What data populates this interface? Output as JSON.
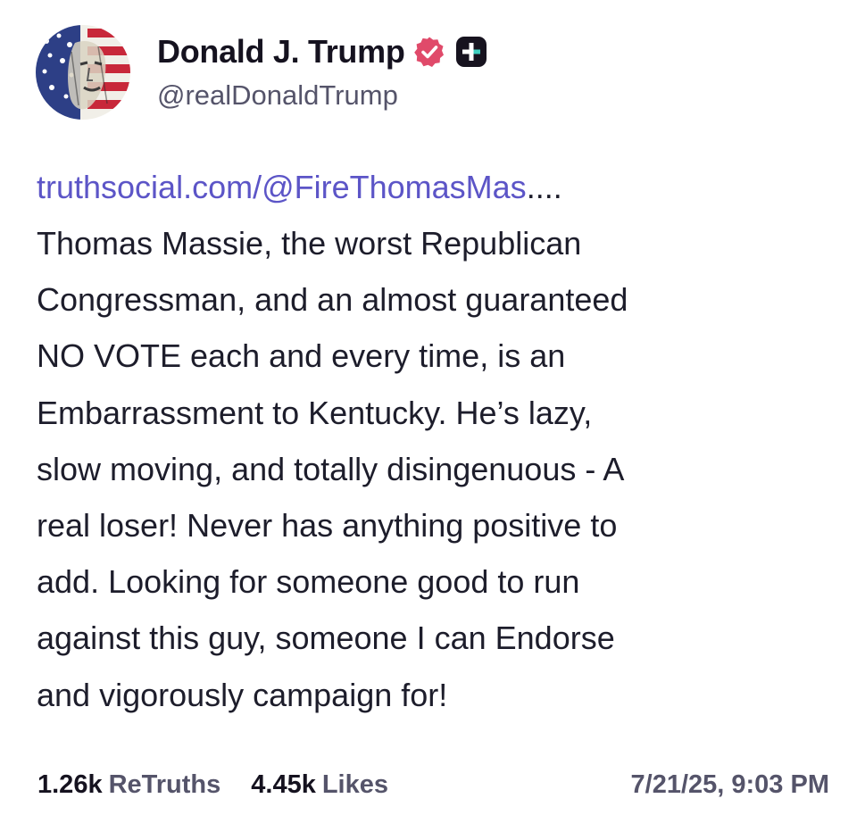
{
  "author": {
    "display_name": "Donald J. Trump",
    "handle": "@realDonaldTrump",
    "verified_icon": "verified-badge-icon",
    "plus_icon": "plus-badge-icon"
  },
  "post": {
    "link_text": "truthsocial.com/@FireThomasMas",
    "link_ellipsis": "....",
    "text": "Thomas Massie, the worst Republican\nCongressman, and an almost guaranteed\nNO VOTE each and every time, is an\nEmbarrassment to Kentucky. He’s lazy,\nslow moving, and totally disingenuous - A\nreal loser! Never has anything positive to\nadd. Looking for someone good to run\nagainst this guy, someone I can Endorse\nand vigorously campaign for!"
  },
  "stats": {
    "retruths_count": "1.26k",
    "retruths_label": "ReTruths",
    "likes_count": "4.45k",
    "likes_label": "Likes",
    "timestamp": "7/21/25, 9:03 PM"
  },
  "colors": {
    "link": "#5c55c7",
    "verified_badge": "#e04a6a",
    "text_primary": "#1d1d2b",
    "text_secondary": "#55546a"
  }
}
